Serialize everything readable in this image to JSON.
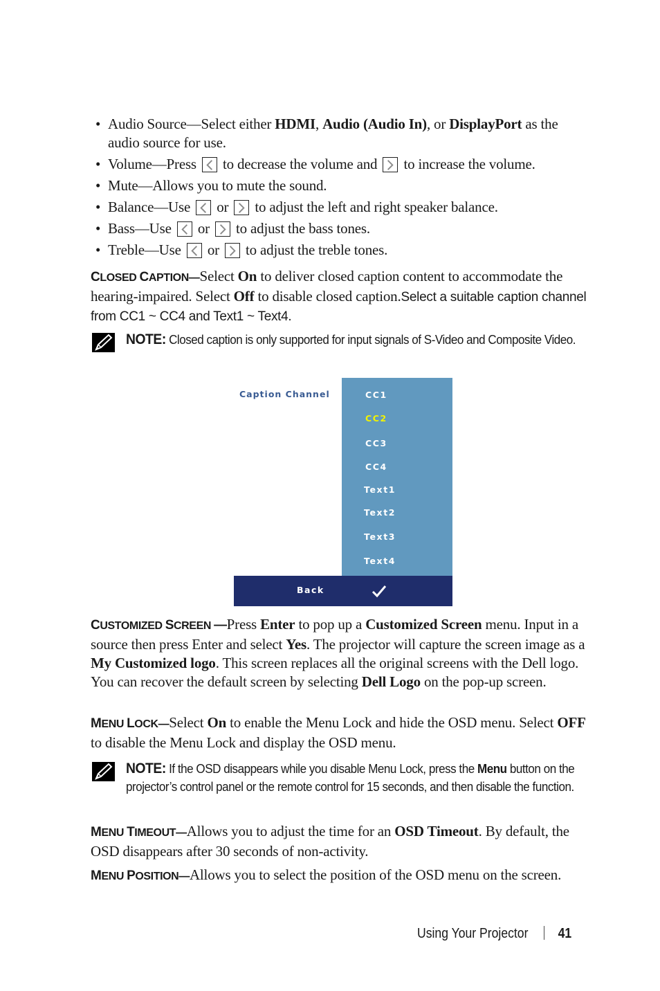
{
  "bullets": [
    {
      "parts": [
        {
          "t": "Audio Source—Select either "
        },
        {
          "t": "HDMI",
          "b": true
        },
        {
          "t": ", "
        },
        {
          "t": "Audio (Audio In)",
          "b": true
        },
        {
          "t": ", or "
        },
        {
          "t": "DisplayPort",
          "b": true
        },
        {
          "t": " as the audio source for use."
        }
      ]
    },
    {
      "parts": [
        {
          "t": "Volume—Press "
        },
        {
          "key": "left-arrow"
        },
        {
          "t": " to decrease the volume and "
        },
        {
          "key": "right-arrow"
        },
        {
          "t": " to increase the volume."
        }
      ]
    },
    {
      "parts": [
        {
          "t": "Mute—Allows you to mute the sound."
        }
      ]
    },
    {
      "parts": [
        {
          "t": "Balance—Use "
        },
        {
          "key": "left-arrow"
        },
        {
          "t": " or "
        },
        {
          "key": "right-arrow"
        },
        {
          "t": " to adjust the left and right speaker balance."
        }
      ]
    },
    {
      "parts": [
        {
          "t": "Bass—Use "
        },
        {
          "key": "left-arrow"
        },
        {
          "t": " or "
        },
        {
          "key": "right-arrow"
        },
        {
          "t": " to adjust the bass tones."
        }
      ]
    },
    {
      "parts": [
        {
          "t": "Treble—Use "
        },
        {
          "key": "left-arrow"
        },
        {
          "t": " or "
        },
        {
          "key": "right-arrow"
        },
        {
          "t": " to adjust the treble tones."
        }
      ]
    }
  ],
  "closed_caption": {
    "heading": "Closed Caption—",
    "parts": [
      {
        "t": "Select "
      },
      {
        "t": "On",
        "b": true
      },
      {
        "t": " to deliver closed caption content to accommodate the hearing-impaired. Select "
      },
      {
        "t": "Off",
        "b": true
      },
      {
        "t": " to disable closed caption."
      },
      {
        "t": "Select a suitable caption channel from CC1 ~ CC4 and Text1 ~ Text4.",
        "sans": true
      }
    ]
  },
  "note1": {
    "label": "NOTE:",
    "text": " Closed caption is only supported for input signals of S-Video and Composite Video."
  },
  "osd_menu": {
    "title": "Caption Channel",
    "items": [
      "CC1",
      "CC2",
      "CC3",
      "CC4",
      "Text1",
      "Text2",
      "Text3",
      "Text4"
    ],
    "selected": "CC2",
    "back_label": "Back",
    "confirm_icon": "checkmark-icon",
    "colors": {
      "list_bg": "#6199bf",
      "bar_bg": "#1f2d6b",
      "title": "#3a5c93",
      "selected": "#f2f200",
      "item": "#ffffff"
    }
  },
  "customized_screen": {
    "heading": "Customized Screen —",
    "parts": [
      {
        "t": "Press "
      },
      {
        "t": "Enter",
        "b": true
      },
      {
        "t": " to pop up a "
      },
      {
        "t": "Customized Screen",
        "b": true
      },
      {
        "t": " menu. Input in a source then press Enter and select "
      },
      {
        "t": "Yes",
        "b": true
      },
      {
        "t": ". The projector will capture the screen image as a "
      },
      {
        "t": "My Customized logo",
        "b": true
      },
      {
        "t": ". This screen replaces all the original screens with the Dell logo. You can recover the default screen by selecting "
      },
      {
        "t": "Dell Logo",
        "b": true
      },
      {
        "t": " on the pop-up screen."
      }
    ]
  },
  "menu_lock": {
    "heading": "Menu Lock—",
    "parts": [
      {
        "t": "Select "
      },
      {
        "t": "On",
        "b": true
      },
      {
        "t": " to enable the Menu Lock and hide the OSD menu. Select "
      },
      {
        "t": "OFF",
        "b": true
      },
      {
        "t": " to disable the Menu Lock and display the OSD menu."
      }
    ]
  },
  "note2": {
    "label": "NOTE:",
    "parts": [
      {
        "t": " If the OSD disappears while you disable Menu Lock, press the "
      },
      {
        "t": "Menu",
        "b": true
      },
      {
        "t": " button on the projector’s control panel or the remote control for 15 seconds, and then disable the function."
      }
    ]
  },
  "menu_timeout": {
    "heading": "Menu Timeout—",
    "parts": [
      {
        "t": "Allows you to adjust the time for an "
      },
      {
        "t": "OSD Timeout",
        "b": true
      },
      {
        "t": ". By default, the OSD disappears after 30 seconds of non-activity."
      }
    ]
  },
  "menu_position": {
    "heading": "Menu Position—",
    "parts": [
      {
        "t": "Allows you to select the position of the OSD menu on the screen."
      }
    ]
  },
  "footer": {
    "section": "Using Your Projector",
    "page_number": "41"
  }
}
